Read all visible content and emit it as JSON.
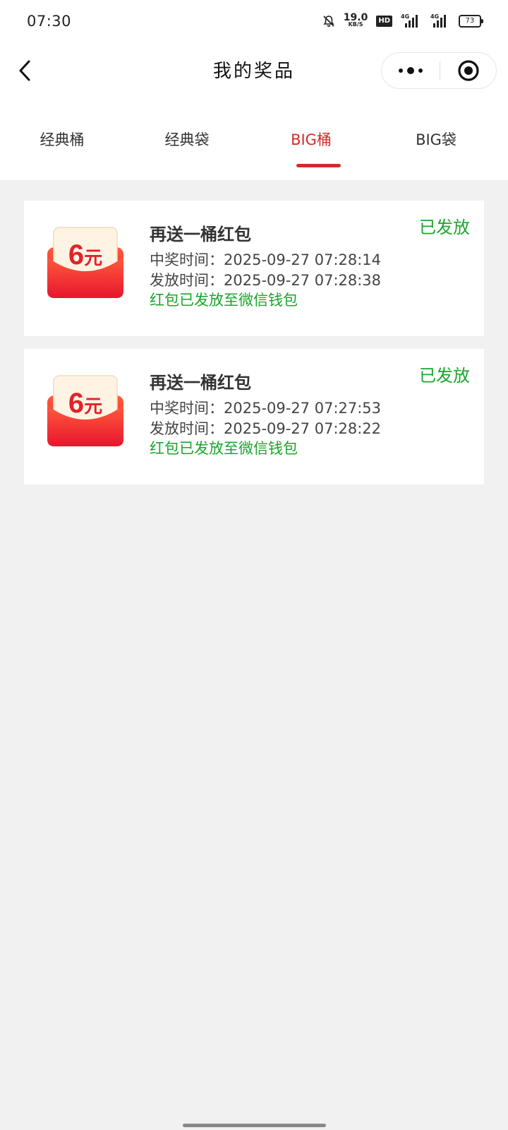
{
  "status_bar": {
    "time": "07:30",
    "speed_value": "19.0",
    "speed_unit": "KB/S",
    "hd_label": "HD",
    "signal_label": "4G",
    "battery": "73"
  },
  "nav": {
    "title": "我的奖品",
    "back_icon": "chevron-left-icon",
    "more_icon": "more-dots-icon",
    "close_icon": "record-target-icon"
  },
  "tabs": [
    {
      "label": "经典桶",
      "active": false
    },
    {
      "label": "经典袋",
      "active": false
    },
    {
      "label": "BIG桶",
      "active": true
    },
    {
      "label": "BIG袋",
      "active": false
    }
  ],
  "prizes": [
    {
      "amount_label": "6元",
      "name": "再送一桶红包",
      "status": "已发放",
      "win_time": "中奖时间：2025-09-27 07:28:14",
      "issue_time": "发放时间：2025-09-27 07:28:38",
      "note": "红包已发放至微信钱包"
    },
    {
      "amount_label": "6元",
      "name": "再送一桶红包",
      "status": "已发放",
      "win_time": "中奖时间：2025-09-27 07:27:53",
      "issue_time": "发放时间：2025-09-27 07:28:22",
      "note": "红包已发放至微信钱包"
    }
  ],
  "colors": {
    "accent_red": "#d42b2b",
    "status_green": "#1aa52b",
    "page_bg": "#f1f1f1"
  }
}
